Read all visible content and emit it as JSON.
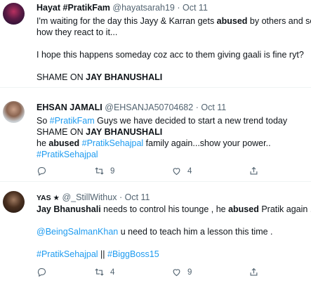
{
  "tweets": [
    {
      "name": "Hayat #PratikFam",
      "handle": "@hayatsarah19",
      "dot": "·",
      "time": "Oct 11",
      "lines": [
        [
          {
            "t": "I'm waiting for the day this Jayy & Karran gets "
          },
          {
            "t": "abused",
            "b": true
          },
          {
            "t": " by others and see"
          }
        ],
        [
          {
            "t": "how they react to it..."
          }
        ],
        [],
        [
          {
            "t": "I hope this happens someday coz acc to them giving gaali is fine ryt?"
          }
        ],
        [],
        [
          {
            "t": "SHAME ON "
          },
          {
            "t": "JAY BHANUSHALI",
            "b": true
          }
        ]
      ]
    },
    {
      "name": "EHSAN JAMALI",
      "handle": "@EHSANJA50704682",
      "dot": "·",
      "time": "Oct 11",
      "lines": [
        [
          {
            "t": "So "
          },
          {
            "t": "#PratikFam",
            "tag": true
          },
          {
            "t": " Guys we have decided to start a new trend today"
          }
        ],
        [
          {
            "t": "SHAME ON "
          },
          {
            "t": "JAY BHANUSHALI",
            "b": true
          }
        ],
        [
          {
            "t": "he "
          },
          {
            "t": "abused",
            "b": true
          },
          {
            "t": " "
          },
          {
            "t": "#PratikSehajpal",
            "tag": true
          },
          {
            "t": " family again...show your power.."
          }
        ],
        [
          {
            "t": "#PratikSehajpal",
            "tag": true
          }
        ]
      ],
      "retweets": "9",
      "likes": "4"
    },
    {
      "name": "YAS ★",
      "handle": "@_StillWithux",
      "dot": "·",
      "time": "Oct 11",
      "lines": [
        [
          {
            "t": "Jay Bhanushali",
            "b": true
          },
          {
            "t": " needs to control his tounge , he "
          },
          {
            "t": "abused",
            "b": true
          },
          {
            "t": " Pratik again ."
          }
        ],
        [],
        [
          {
            "t": "@BeingSalmanKhan",
            "tag": true
          },
          {
            "t": " u need to teach him a lesson this time ."
          }
        ],
        [],
        [
          {
            "t": "#PratikSehajpal",
            "tag": true
          },
          {
            "t": " || "
          },
          {
            "t": "#BiggBoss15",
            "tag": true
          }
        ]
      ],
      "retweets": "4",
      "likes": "9"
    }
  ],
  "icons": {
    "reply": "reply-icon",
    "retweet": "retweet-icon",
    "like": "like-icon",
    "share": "share-icon"
  },
  "colors": {
    "link": "#1d9bf0",
    "meta": "#536471",
    "text": "#0f1419",
    "divider": "#eff3f4"
  }
}
